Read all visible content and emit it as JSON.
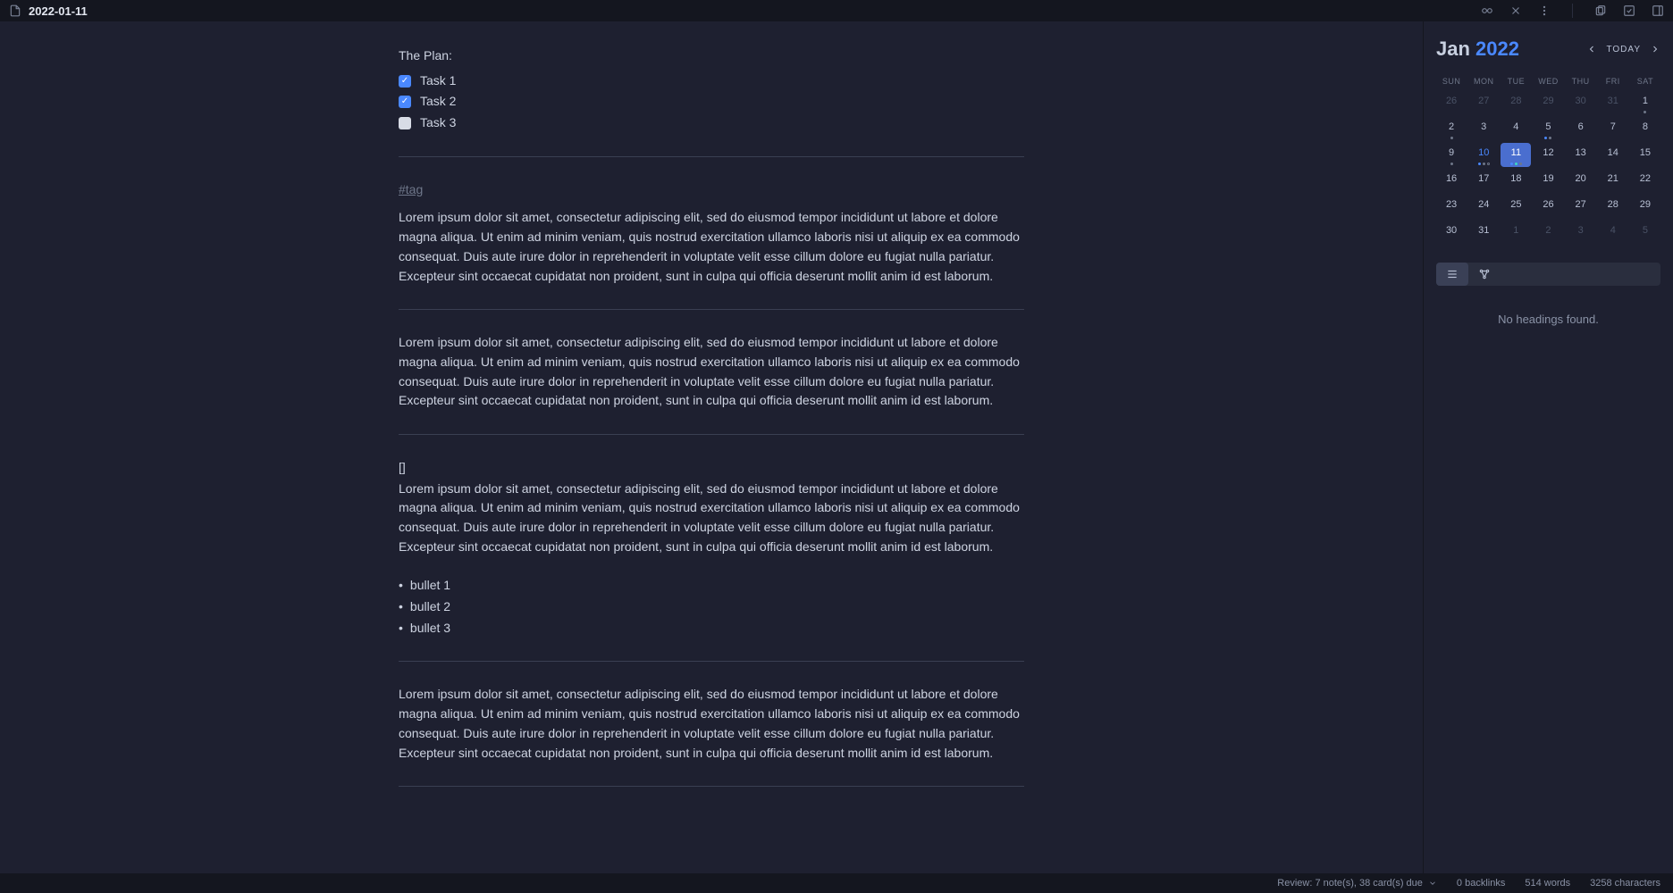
{
  "titlebar": {
    "title": "2022-01-11"
  },
  "note": {
    "plan_label": "The Plan:",
    "tasks": [
      {
        "label": "Task 1",
        "checked": true
      },
      {
        "label": "Task 2",
        "checked": true
      },
      {
        "label": "Task 3",
        "checked": false
      }
    ],
    "tag": "#tag",
    "lorem": "Lorem ipsum dolor sit amet, consectetur adipiscing elit, sed do eiusmod tempor incididunt ut labore et dolore magna aliqua. Ut enim ad minim veniam, quis nostrud exercitation ullamco laboris nisi ut aliquip ex ea commodo consequat. Duis aute irure dolor in reprehenderit in voluptate velit esse cillum dolore eu fugiat nulla pariatur. Excepteur sint occaecat cupidatat non proident, sunt in culpa qui officia deserunt mollit anim id est laborum.",
    "bracket": "[]",
    "bullets": [
      "bullet 1",
      "bullet 2",
      "bullet 3"
    ]
  },
  "calendar": {
    "month": "Jan",
    "year": "2022",
    "today_label": "TODAY",
    "dow": [
      "SUN",
      "MON",
      "TUE",
      "WED",
      "THU",
      "FRI",
      "SAT"
    ],
    "days": [
      {
        "n": "26",
        "other": true
      },
      {
        "n": "27",
        "other": true
      },
      {
        "n": "28",
        "other": true
      },
      {
        "n": "29",
        "other": true
      },
      {
        "n": "30",
        "other": true
      },
      {
        "n": "31",
        "other": true
      },
      {
        "n": "1",
        "dots": [
          "grey"
        ]
      },
      {
        "n": "2",
        "dots": [
          "grey"
        ]
      },
      {
        "n": "3"
      },
      {
        "n": "4"
      },
      {
        "n": "5",
        "dots": [
          "blue",
          "grey"
        ]
      },
      {
        "n": "6"
      },
      {
        "n": "7"
      },
      {
        "n": "8"
      },
      {
        "n": "9",
        "dots": [
          "grey"
        ]
      },
      {
        "n": "10",
        "today": true,
        "dots": [
          "blue",
          "grey",
          "hollow"
        ]
      },
      {
        "n": "11",
        "selected": true,
        "dots": [
          "blue",
          "teal",
          "grey"
        ]
      },
      {
        "n": "12"
      },
      {
        "n": "13"
      },
      {
        "n": "14"
      },
      {
        "n": "15"
      },
      {
        "n": "16"
      },
      {
        "n": "17"
      },
      {
        "n": "18"
      },
      {
        "n": "19"
      },
      {
        "n": "20"
      },
      {
        "n": "21"
      },
      {
        "n": "22"
      },
      {
        "n": "23"
      },
      {
        "n": "24"
      },
      {
        "n": "25"
      },
      {
        "n": "26"
      },
      {
        "n": "27"
      },
      {
        "n": "28"
      },
      {
        "n": "29"
      },
      {
        "n": "30"
      },
      {
        "n": "31"
      },
      {
        "n": "1",
        "other": true
      },
      {
        "n": "2",
        "other": true
      },
      {
        "n": "3",
        "other": true
      },
      {
        "n": "4",
        "other": true
      },
      {
        "n": "5",
        "other": true
      }
    ]
  },
  "outline": {
    "empty": "No headings found."
  },
  "status": {
    "review": "Review: 7 note(s), 38 card(s) due",
    "backlinks": "0 backlinks",
    "words": "514 words",
    "chars": "3258 characters"
  }
}
